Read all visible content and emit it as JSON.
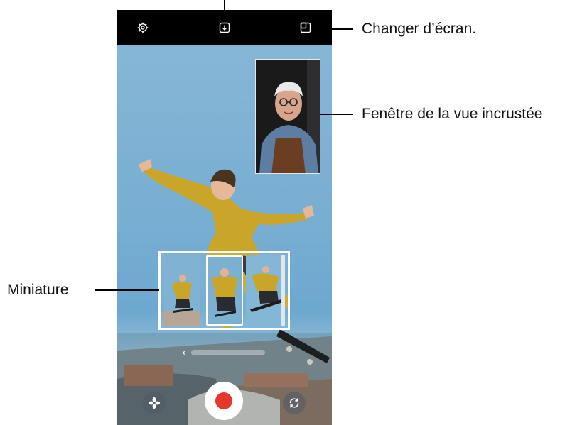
{
  "callouts": {
    "switch_screen": "Changer d’écran.",
    "pip_window": "Fenêtre de la vue incrustée",
    "thumbnail": "Miniature"
  },
  "topbar": {
    "icons": [
      "settings-icon",
      "download-icon",
      "screen-switch-icon"
    ]
  },
  "controls": {
    "left_icon": "filter-flower-icon",
    "shutter_icon": "record-icon",
    "right_icon": "switch-camera-icon",
    "mode_chevron": "‹"
  },
  "colors": {
    "record_red": "#e5372b",
    "topbar_black": "#000000"
  }
}
